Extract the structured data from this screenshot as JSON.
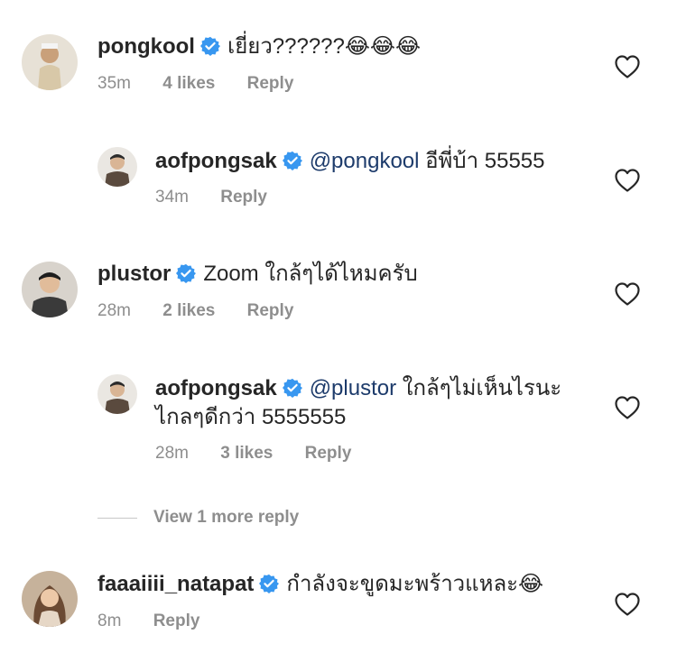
{
  "comments": [
    {
      "username": "pongkool",
      "text": "เยี่ยว??????😂😂😂",
      "time": "35m",
      "likes": "4 likes",
      "reply": "Reply"
    },
    {
      "username": "aofpongsak",
      "mention": "@pongkool",
      "text": "อีพี่บ้า 55555",
      "time": "34m",
      "reply": "Reply"
    },
    {
      "username": "plustor",
      "text": "Zoom ใกล้ๆได้ไหมครับ",
      "time": "28m",
      "likes": "2 likes",
      "reply": "Reply"
    },
    {
      "username": "aofpongsak",
      "mention": "@plustor",
      "text": "ใกล้ๆไม่เห็นไรนะ",
      "text_line2": "ไกลๆดีกว่า 5555555",
      "time": "28m",
      "likes": "3 likes",
      "reply": "Reply"
    },
    {
      "username": "faaaiiii_natapat",
      "text": "กำลังจะขูดมะพร้าวแหละ😂",
      "time": "8m",
      "reply": "Reply"
    }
  ],
  "view_more_replies": "View 1 more reply",
  "icons": {
    "verified": "verified-badge-icon",
    "like": "heart-icon"
  },
  "colors": {
    "verified_blue": "#3897f0",
    "mention": "#1d3b6b",
    "meta_gray": "#8e8e8e"
  }
}
